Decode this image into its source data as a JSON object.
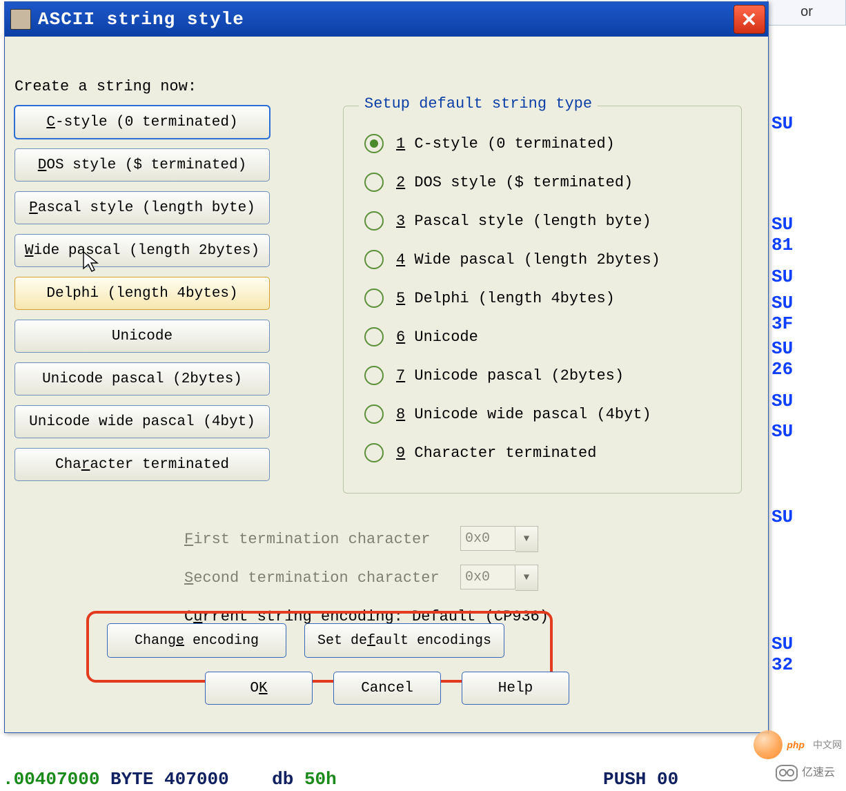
{
  "partial_tab_label": "or",
  "dialog": {
    "title": "ASCII string style",
    "prompt": "Create a string now:",
    "style_buttons": [
      {
        "pre": "",
        "u": "C",
        "post": "-style (0 terminated)"
      },
      {
        "pre": "",
        "u": "D",
        "post": "OS style ($ terminated)"
      },
      {
        "pre": "",
        "u": "P",
        "post": "ascal style (length byte)"
      },
      {
        "pre": "",
        "u": "W",
        "post": "ide pascal (length 2bytes)"
      },
      {
        "pre": "Delphi (length 4bytes)",
        "u": "",
        "post": ""
      },
      {
        "pre": "Unicode",
        "u": "",
        "post": ""
      },
      {
        "pre": "Unicode pascal (2bytes)",
        "u": "",
        "post": ""
      },
      {
        "pre": "Unicode wide pascal (4byt)",
        "u": "",
        "post": ""
      },
      {
        "pre": "Cha",
        "u": "r",
        "post": "acter terminated"
      }
    ],
    "group_title": "Setup default string type",
    "radio_items": [
      {
        "num": "1",
        "label": "C-style (0 terminated)"
      },
      {
        "num": "2",
        "label": "DOS style ($ terminated)"
      },
      {
        "num": "3",
        "label": "Pascal style (length byte)"
      },
      {
        "num": "4",
        "label": "Wide pascal (length 2bytes)"
      },
      {
        "num": "5",
        "label": "Delphi (length 4bytes)"
      },
      {
        "num": "6",
        "label": "Unicode"
      },
      {
        "num": "7",
        "label": "Unicode pascal (2bytes)"
      },
      {
        "num": "8",
        "label": "Unicode wide pascal (4byt)"
      },
      {
        "num": "9",
        "label": "Character terminated"
      }
    ],
    "selected_radio_index": 0,
    "focused_button_index": 0,
    "hot_button_index": 4,
    "first_term": {
      "pre": "",
      "u": "F",
      "post": "irst termination character",
      "value": "0x0"
    },
    "second_term": {
      "pre": "",
      "u": "S",
      "post": "econd termination character",
      "value": "0x0"
    },
    "current_encoding": {
      "pre": "C",
      "u": "u",
      "post": "rrent string encoding:  Default (CP936)"
    },
    "change_enc": {
      "pre": "Chang",
      "u": "e",
      "post": " encoding"
    },
    "set_default_enc": {
      "pre": "Set de",
      "u": "f",
      "post": "ault encodings"
    },
    "ok": {
      "pre": "O",
      "u": "K",
      "post": ""
    },
    "cancel": "Cancel",
    "help": "Help"
  },
  "background_fragments": [
    "SU",
    "SU",
    "81",
    "SU",
    "SU",
    "3F",
    "SU",
    "26",
    "SU",
    "SU",
    "SU",
    "SU",
    "32"
  ],
  "bottom_code": {
    "addr": ".00407000",
    "mid": "BYTE 407000",
    "op": "db",
    "val": "50h",
    "right": "PUSH 00"
  },
  "watermark": {
    "a": "php",
    "b": "中文网",
    "c": "亿速云"
  }
}
